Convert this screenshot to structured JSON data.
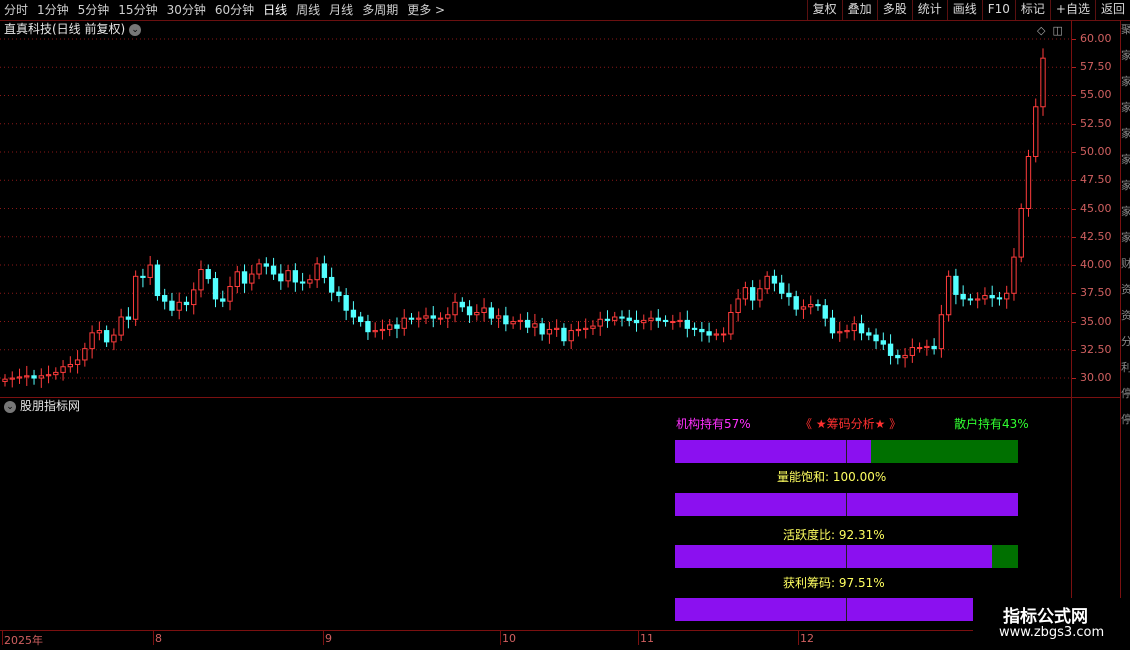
{
  "toolbar": {
    "periods": [
      "分时",
      "1分钟",
      "5分钟",
      "15分钟",
      "30分钟",
      "60分钟",
      "日线",
      "周线",
      "月线",
      "多周期",
      "更多 >"
    ],
    "active_period": "日线",
    "tools": [
      "复权",
      "叠加",
      "多股",
      "统计",
      "画线",
      "F10",
      "标记",
      "+自选",
      "返回"
    ]
  },
  "stock": {
    "title": "直真科技(日线 前复权)"
  },
  "price_axis": {
    "labels": [
      "60.00",
      "57.50",
      "55.00",
      "52.50",
      "50.00",
      "47.50",
      "45.00",
      "42.50",
      "40.00",
      "37.50",
      "35.00",
      "32.50",
      "30.00"
    ]
  },
  "right_strip_chars": [
    "聚",
    "家",
    "家",
    "家",
    "家",
    "家",
    "家",
    "家",
    "家",
    "财",
    "资",
    "资",
    "分",
    "利",
    "停",
    "停"
  ],
  "indicator": {
    "title": "股朋指标网"
  },
  "chips_panel": {
    "title": "《 ★筹码分析★ 》",
    "institution_label": "机构持有57%",
    "retail_label": "散户持有43%",
    "volume_label": "量能饱和:  100.00%",
    "activity_label": "活跃度比:  92.31%",
    "profit_label": "获利筹码:  97.51%",
    "institution_pct": 57,
    "volume_pct": 100,
    "activity_pct": 92.31,
    "profit_pct": 97.51,
    "colors": {
      "purple": "#8b10f0",
      "green": "#007000",
      "magenta": "#ff30ff",
      "yellow": "#ffff60",
      "lime": "#30ff30",
      "red": "#ff3030"
    }
  },
  "date_axis": {
    "labels": [
      "2025年",
      "8",
      "9",
      "10",
      "11",
      "12"
    ]
  },
  "watermark": {
    "title": "指标公式网",
    "url": "www.zbgs3.com"
  },
  "chart_data": {
    "type": "candlestick",
    "ylim": [
      28.5,
      61.5
    ],
    "y_ticks": [
      60.0,
      57.5,
      55.0,
      52.5,
      50.0,
      47.5,
      45.0,
      42.5,
      40.0,
      37.5,
      35.0,
      32.5,
      30.0
    ],
    "x_month_labels": [
      "2025年",
      "8",
      "9",
      "10",
      "11",
      "12"
    ],
    "closes": [
      29.9,
      30.0,
      30.1,
      30.2,
      30.0,
      30.2,
      30.3,
      30.5,
      31.0,
      31.2,
      31.6,
      32.6,
      34.0,
      34.2,
      33.2,
      33.8,
      35.4,
      35.2,
      39.0,
      38.9,
      40.0,
      37.3,
      36.8,
      36.0,
      36.7,
      36.5,
      37.8,
      39.6,
      38.8,
      37.0,
      36.8,
      38.1,
      39.4,
      38.4,
      39.2,
      40.1,
      39.9,
      39.2,
      38.6,
      39.5,
      38.5,
      38.4,
      38.7,
      40.1,
      38.9,
      37.6,
      37.3,
      36.0,
      35.4,
      35.0,
      34.1,
      34.2,
      34.3,
      34.7,
      34.4,
      35.3,
      35.2,
      35.3,
      35.5,
      35.3,
      35.3,
      35.6,
      36.7,
      36.3,
      35.6,
      35.8,
      36.2,
      35.3,
      35.5,
      34.8,
      35.0,
      35.1,
      34.5,
      34.8,
      33.9,
      34.3,
      34.4,
      33.3,
      34.2,
      34.3,
      34.4,
      34.6,
      35.2,
      35.1,
      35.4,
      35.3,
      35.1,
      34.9,
      35.1,
      35.3,
      35.1,
      35.0,
      35.0,
      35.1,
      34.4,
      34.3,
      34.1,
      33.8,
      33.9,
      33.9,
      35.8,
      37.0,
      38.0,
      36.9,
      37.9,
      39.0,
      38.4,
      37.5,
      37.2,
      36.1,
      36.3,
      36.5,
      36.4,
      35.3,
      34.0,
      34.1,
      34.2,
      34.8,
      34.0,
      33.8,
      33.3,
      33.0,
      32.0,
      31.8,
      32.0,
      32.7,
      32.7,
      32.8,
      32.6,
      35.6,
      39.0,
      37.4,
      37.0,
      36.9,
      37.0,
      37.3,
      37.1,
      37.0,
      37.5,
      40.7,
      45.0,
      49.6,
      54.0,
      58.3
    ]
  }
}
